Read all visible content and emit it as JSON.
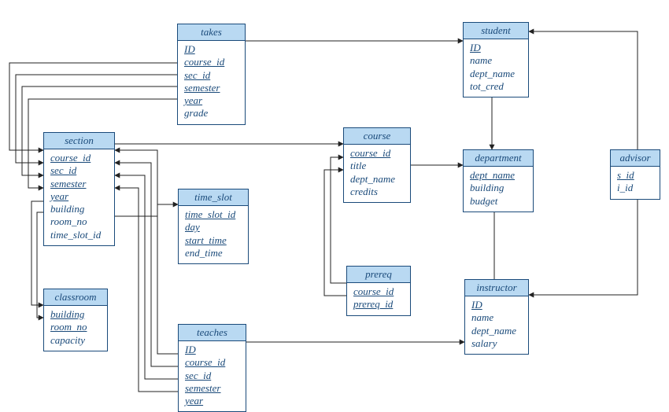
{
  "diagram": {
    "entities": {
      "takes": {
        "title": "takes",
        "attrs": [
          {
            "label": "ID",
            "pk": true
          },
          {
            "label": "course_id",
            "pk": true
          },
          {
            "label": "sec_id",
            "pk": true
          },
          {
            "label": "semester",
            "pk": true
          },
          {
            "label": "year",
            "pk": true
          },
          {
            "label": "grade",
            "pk": false
          }
        ]
      },
      "student": {
        "title": "student",
        "attrs": [
          {
            "label": "ID",
            "pk": true
          },
          {
            "label": "name",
            "pk": false
          },
          {
            "label": "dept_name",
            "pk": false
          },
          {
            "label": "tot_cred",
            "pk": false
          }
        ]
      },
      "section": {
        "title": "section",
        "attrs": [
          {
            "label": "course_id",
            "pk": true
          },
          {
            "label": "sec_id",
            "pk": true
          },
          {
            "label": "semester",
            "pk": true
          },
          {
            "label": "year",
            "pk": true
          },
          {
            "label": "building",
            "pk": false
          },
          {
            "label": "room_no",
            "pk": false
          },
          {
            "label": "time_slot_id",
            "pk": false
          }
        ]
      },
      "course": {
        "title": "course",
        "attrs": [
          {
            "label": "course_id",
            "pk": true
          },
          {
            "label": "title",
            "pk": false
          },
          {
            "label": "dept_name",
            "pk": false
          },
          {
            "label": "credits",
            "pk": false
          }
        ]
      },
      "department": {
        "title": "department",
        "attrs": [
          {
            "label": "dept_name",
            "pk": true
          },
          {
            "label": "building",
            "pk": false
          },
          {
            "label": "budget",
            "pk": false
          }
        ]
      },
      "advisor": {
        "title": "advisor",
        "attrs": [
          {
            "label": "s_id",
            "pk": true
          },
          {
            "label": "i_id",
            "pk": false
          }
        ]
      },
      "time_slot": {
        "title": "time_slot",
        "attrs": [
          {
            "label": "time_slot_id",
            "pk": true
          },
          {
            "label": "day",
            "pk": true
          },
          {
            "label": "start_time",
            "pk": true
          },
          {
            "label": "end_time",
            "pk": false
          }
        ]
      },
      "prereq": {
        "title": "prereq",
        "attrs": [
          {
            "label": "course_id",
            "pk": true
          },
          {
            "label": "prereq_id",
            "pk": true
          }
        ]
      },
      "instructor": {
        "title": "instructor",
        "attrs": [
          {
            "label": "ID",
            "pk": true
          },
          {
            "label": "name",
            "pk": false
          },
          {
            "label": "dept_name",
            "pk": false
          },
          {
            "label": "salary",
            "pk": false
          }
        ]
      },
      "classroom": {
        "title": "classroom",
        "attrs": [
          {
            "label": "building",
            "pk": true
          },
          {
            "label": "room_no",
            "pk": true
          },
          {
            "label": "capacity",
            "pk": false
          }
        ]
      },
      "teaches": {
        "title": "teaches",
        "attrs": [
          {
            "label": "ID",
            "pk": true
          },
          {
            "label": "course_id",
            "pk": true
          },
          {
            "label": "sec_id",
            "pk": true
          },
          {
            "label": "semester",
            "pk": true
          },
          {
            "label": "year",
            "pk": true
          }
        ]
      }
    },
    "relationships": [
      {
        "from": "takes",
        "to": "student"
      },
      {
        "from": "takes",
        "to": "section"
      },
      {
        "from": "student",
        "to": "department"
      },
      {
        "from": "advisor",
        "to": "student"
      },
      {
        "from": "advisor",
        "to": "instructor"
      },
      {
        "from": "section",
        "to": "course"
      },
      {
        "from": "section",
        "to": "time_slot"
      },
      {
        "from": "section",
        "to": "classroom"
      },
      {
        "from": "course",
        "to": "department"
      },
      {
        "from": "prereq",
        "to": "course"
      },
      {
        "from": "instructor",
        "to": "department"
      },
      {
        "from": "teaches",
        "to": "instructor"
      },
      {
        "from": "teaches",
        "to": "section"
      }
    ]
  }
}
